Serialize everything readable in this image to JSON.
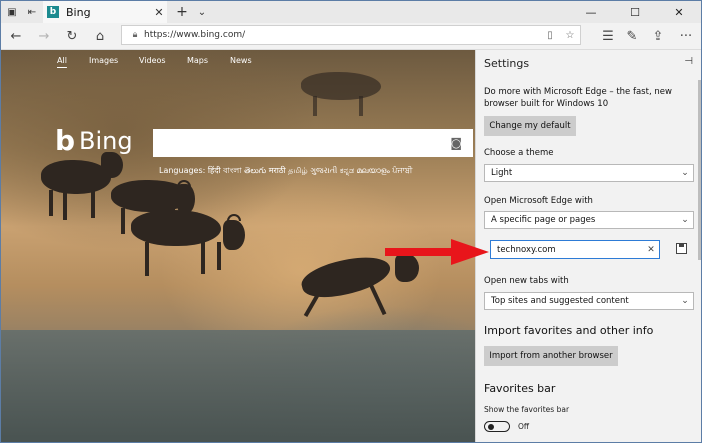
{
  "browser": {
    "tab_title": "Bing",
    "tab_favicon": "b",
    "url": "https://www.bing.com/"
  },
  "bing": {
    "nav": [
      "All",
      "Images",
      "Videos",
      "Maps",
      "News"
    ],
    "logo_text": "Bing",
    "languages": "Languages: हिंदी  বাংলা  తెలుగు  मराठी  தமிழ்  ગુજરાતી  ಕನ್ನಡ  മലയാളം  ਪੰਜਾਬੀ"
  },
  "settings": {
    "title": "Settings",
    "promo_text": "Do more with Microsoft Edge – the fast, new browser built for Windows 10",
    "change_default_label": "Change my default",
    "theme_label": "Choose a theme",
    "theme_value": "Light",
    "open_with_label": "Open Microsoft Edge with",
    "open_with_value": "A specific page or pages",
    "page_value": "technoxy.com",
    "new_tabs_label": "Open new tabs with",
    "new_tabs_value": "Top sites and suggested content",
    "import_title": "Import favorites and other info",
    "import_button_label": "Import from another browser",
    "favorites_title": "Favorites bar",
    "show_favorites_label": "Show the favorites bar",
    "toggle_state": "Off"
  },
  "icons": {
    "back": "←",
    "forward": "→",
    "refresh": "↻",
    "home": "⌂",
    "reading": "▯",
    "star": "☆",
    "hub": "☰",
    "pen": "✎",
    "share": "⇪",
    "more": "···",
    "camera": "◙",
    "pin": "⊣",
    "close": "✕",
    "chevron": "⌄"
  },
  "colors": {
    "arrow": "#e8151b",
    "input_border": "#2d7bd6"
  }
}
